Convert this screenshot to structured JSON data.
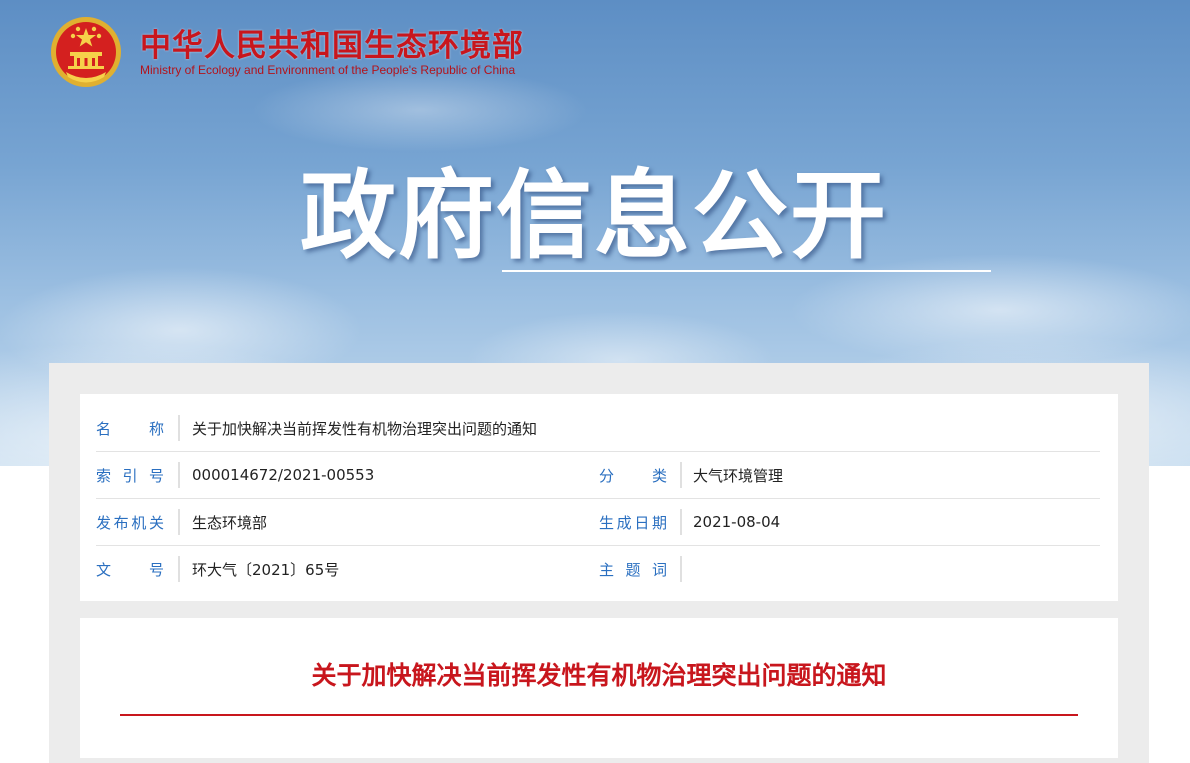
{
  "header": {
    "ministry_cn": "中华人民共和国生态环境部",
    "ministry_en": "Ministry of Ecology and Environment of the People's Republic of China",
    "emblem_icon": "national-emblem-icon"
  },
  "banner": {
    "title": "政府信息公开"
  },
  "metadata": {
    "name_label": "名　　称",
    "name_value": "关于加快解决当前挥发性有机物治理突出问题的通知",
    "index_label": "索 引 号",
    "index_value": "000014672/2021-00553",
    "category_label": "分　　类",
    "category_value": "大气环境管理",
    "publisher_label": "发布机关",
    "publisher_value": "生态环境部",
    "date_label": "生成日期",
    "date_value": "2021-08-04",
    "doc_label": "文　　号",
    "doc_value": "环大气〔2021〕65号",
    "subject_label": "主 题 词",
    "subject_value": ""
  },
  "article": {
    "title": "关于加快解决当前挥发性有机物治理突出问题的通知"
  },
  "colors": {
    "brand_red": "#c8161d",
    "label_blue": "#2a6fc0"
  }
}
